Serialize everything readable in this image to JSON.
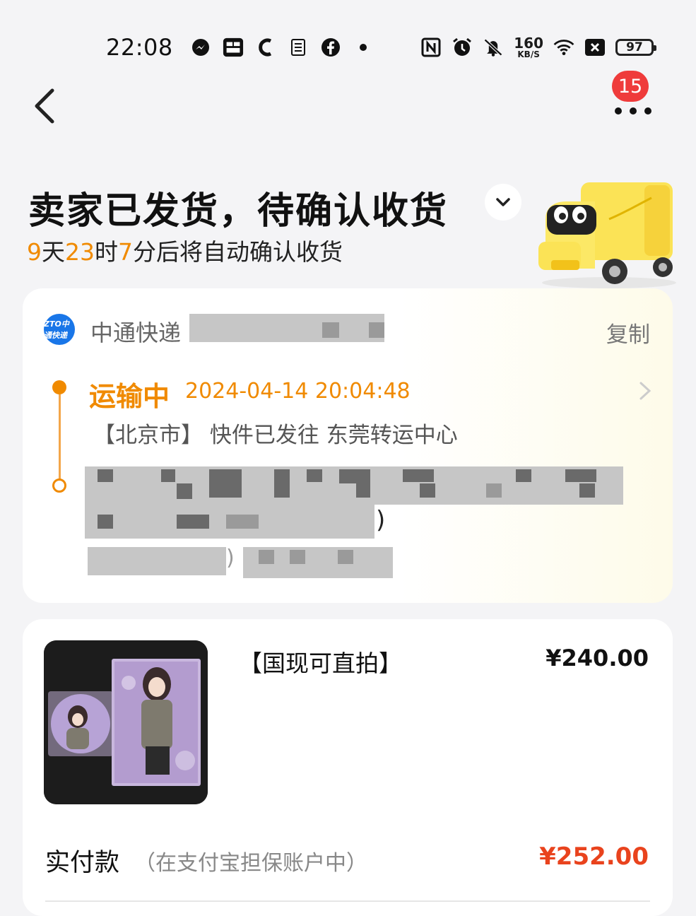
{
  "status_bar": {
    "time": "22:08",
    "net_speed": "160",
    "net_unit": "KB/S",
    "battery": "97",
    "left_icons": [
      "messenger-icon",
      "app-icon",
      "c-icon",
      "app-icon-2",
      "facebook-icon",
      "dot-icon"
    ],
    "right_icons": [
      "nfc-icon",
      "alarm-icon",
      "mute-icon",
      "wifi-icon",
      "sim-icon"
    ]
  },
  "nav": {
    "badge_count": "15"
  },
  "header": {
    "title": "卖家已发货，待确认收货",
    "countdown": {
      "days": "9",
      "days_unit": "天",
      "hours": "23",
      "hours_unit": "时",
      "minutes": "7",
      "suffix": "分后将自动确认收货"
    }
  },
  "logistics": {
    "courier": "中通快递",
    "courier_logo_text": "ZTO中通快递",
    "copy_label": "复制",
    "status": "运输中",
    "time": "2024-04-14 20:04:48",
    "description": "【北京市】 快件已发往 东莞转运中心",
    "paren_1": ")",
    "paren_2": ")"
  },
  "product": {
    "title": "【国现可直拍】",
    "price": "¥240.00",
    "paid_label": "实付款",
    "paid_note": "（在支付宝担保账户中）",
    "paid_amount": "¥252.00"
  },
  "colors": {
    "accent_orange": "#f08a00",
    "price_red": "#e9431d",
    "badge_red": "#ef3b3b",
    "courier_blue": "#1976e8"
  }
}
